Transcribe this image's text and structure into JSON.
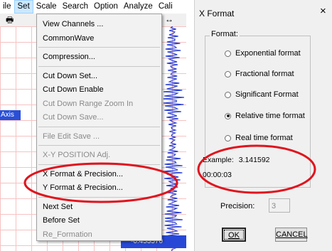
{
  "menubar": {
    "items": [
      "ile",
      "Set",
      "Scale",
      "Search",
      "Option",
      "Analyze",
      "Cali"
    ]
  },
  "toolbar": {
    "printer_icon": "printer-icon",
    "arrow_icon": "double-arrow-icon",
    "arrow_glyph": "↔"
  },
  "plot": {
    "axis_tag": "Axis",
    "bottom_value": "-0.453570"
  },
  "dropdown": {
    "groups": [
      [
        "View Channels ...",
        "CommonWave"
      ],
      [
        "Compression..."
      ],
      [
        "Cut Down Set...",
        "Cut Down Enable",
        "Cut Down Range Zoom In",
        "Cut Down Save..."
      ],
      [
        "File Edit Save ..."
      ],
      [
        "X-Y POSITION Adj."
      ],
      [
        "X Format & Precision...",
        "Y Format & Precision..."
      ],
      [
        "Next Set",
        "Before Set",
        "Re_Formation"
      ]
    ],
    "disabled": [
      "Cut Down Range Zoom In",
      "Cut Down Save...",
      "File Edit Save ...",
      "X-Y POSITION Adj.",
      "Re_Formation"
    ]
  },
  "dialog": {
    "title": "X Format",
    "close": "×",
    "group_label": "Format:",
    "options": [
      {
        "label": "Exponential format",
        "checked": false
      },
      {
        "label": "Fractional format",
        "checked": false
      },
      {
        "label": "Significant Format",
        "checked": false
      },
      {
        "label": "Relative time format",
        "checked": true
      },
      {
        "label": "Real time format",
        "checked": false
      }
    ],
    "example_label": "Example:",
    "example_value": "3.141592",
    "time_value": "00:00:03",
    "precision_label": "Precision:",
    "precision_value": "3",
    "ok_label": "OK",
    "cancel_label": "CANCEL"
  },
  "colors": {
    "annotation": "#e0141e",
    "menu_highlight": "#cce8ff",
    "wave": "#2a3fd6"
  }
}
